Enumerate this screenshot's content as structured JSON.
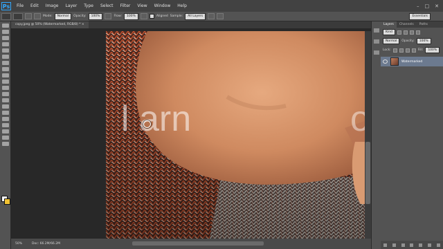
{
  "app": {
    "logo": "Ps",
    "accent": "#31a8ff"
  },
  "menu": [
    "File",
    "Edit",
    "Image",
    "Layer",
    "Type",
    "Select",
    "Filter",
    "View",
    "Window",
    "Help"
  ],
  "window_controls": [
    "–",
    "□",
    "✕"
  ],
  "options": {
    "mode_label": "Mode:",
    "mode_value": "Normal",
    "opacity_label": "Opacity:",
    "opacity_value": "100%",
    "flow_label": "Flow:",
    "flow_value": "100%",
    "aligned_label": "Aligned",
    "sample_label": "Sample:",
    "sample_value": "All Layers",
    "workspace": "Essentials"
  },
  "document": {
    "tab_title": "copy.jpeg @ 50% (Watermarked, RGB/8) *",
    "close": "×"
  },
  "canvas": {
    "watermark_text": "l arn",
    "watermark_right": "o"
  },
  "status": {
    "zoom": "50%",
    "doc": "Doc: 66.2M/66.2M"
  },
  "layers_panel": {
    "tabs": [
      "Layers",
      "Channels",
      "Paths"
    ],
    "kind_label": "Kind",
    "blend_mode": "Normal",
    "opacity_label": "Opacity:",
    "opacity_value": "100%",
    "lock_label": "Lock:",
    "fill_label": "Fill:",
    "fill_value": "100%",
    "layer_name": "Watermarked"
  }
}
